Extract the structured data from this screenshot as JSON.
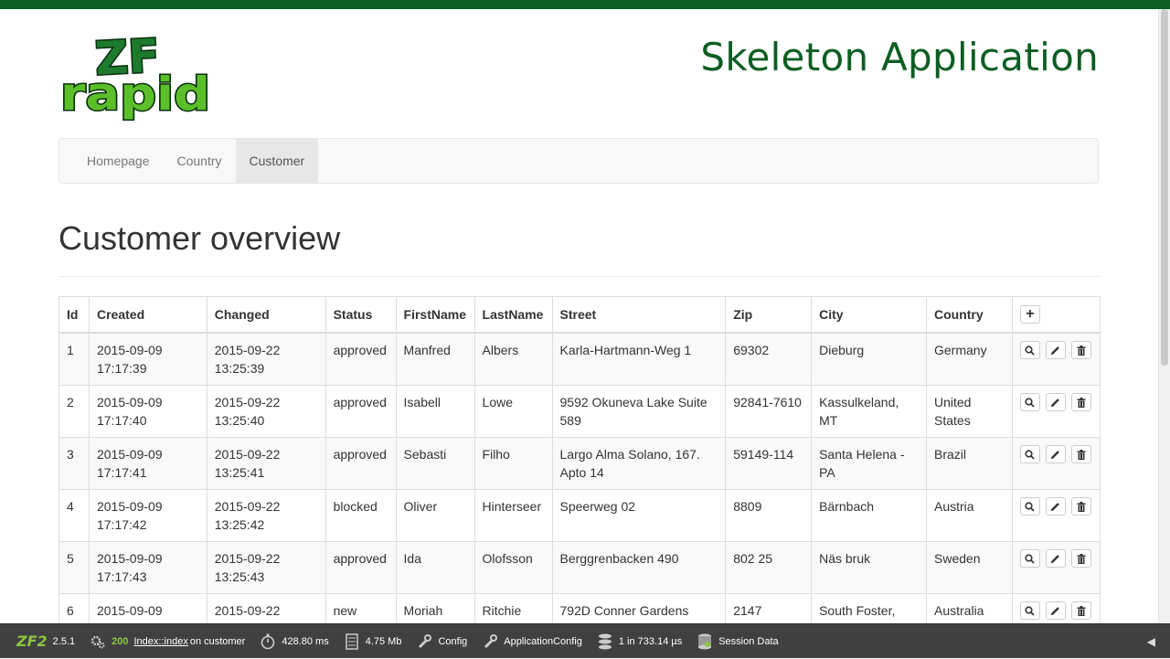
{
  "header": {
    "logo_top": "ZF",
    "logo_bottom": "rapid",
    "app_title": "Skeleton Application"
  },
  "nav": {
    "items": [
      {
        "label": "Homepage",
        "active": false
      },
      {
        "label": "Country",
        "active": false
      },
      {
        "label": "Customer",
        "active": true
      }
    ]
  },
  "page": {
    "title": "Customer overview"
  },
  "table": {
    "columns": [
      "Id",
      "Created",
      "Changed",
      "Status",
      "FirstName",
      "LastName",
      "Street",
      "Zip",
      "City",
      "Country"
    ],
    "add_icon": "plus-icon",
    "rows": [
      {
        "id": "1",
        "created_date": "2015-09-09",
        "created_time": "17:17:39",
        "changed_date": "2015-09-22",
        "changed_time": "13:25:39",
        "status": "approved",
        "firstname": "Manfred",
        "lastname": "Albers",
        "street": "Karla-Hartmann-Weg 1",
        "zip": "69302",
        "city": "Dieburg",
        "country": "Germany"
      },
      {
        "id": "2",
        "created_date": "2015-09-09",
        "created_time": "17:17:40",
        "changed_date": "2015-09-22",
        "changed_time": "13:25:40",
        "status": "approved",
        "firstname": "Isabell",
        "lastname": "Lowe",
        "street": "9592 Okuneva Lake Suite 589",
        "zip": "92841-7610",
        "city": "Kassulkeland, MT",
        "country": "United States"
      },
      {
        "id": "3",
        "created_date": "2015-09-09",
        "created_time": "17:17:41",
        "changed_date": "2015-09-22",
        "changed_time": "13:25:41",
        "status": "approved",
        "firstname": "Sebasti",
        "lastname": "Filho",
        "street": "Largo Alma Solano, 167. Apto 14",
        "zip": "59149-114",
        "city": "Santa Helena - PA",
        "country": "Brazil"
      },
      {
        "id": "4",
        "created_date": "2015-09-09",
        "created_time": "17:17:42",
        "changed_date": "2015-09-22",
        "changed_time": "13:25:42",
        "status": "blocked",
        "firstname": "Oliver",
        "lastname": "Hinterseer",
        "street": "Speerweg 02",
        "zip": "8809",
        "city": "Bärnbach",
        "country": "Austria"
      },
      {
        "id": "5",
        "created_date": "2015-09-09",
        "created_time": "17:17:43",
        "changed_date": "2015-09-22",
        "changed_time": "13:25:43",
        "status": "approved",
        "firstname": "Ida",
        "lastname": "Olofsson",
        "street": "Berggrenbacken 490",
        "zip": "802 25",
        "city": "Näs bruk",
        "country": "Sweden"
      },
      {
        "id": "6",
        "created_date": "2015-09-09",
        "created_time": "",
        "changed_date": "2015-09-22",
        "changed_time": "",
        "status": "new",
        "firstname": "Moriah",
        "lastname": "Ritchie",
        "street": "792D Conner Gardens",
        "zip": "2147",
        "city": "South Foster,",
        "country": "Australia"
      }
    ]
  },
  "toolbar": {
    "logo": "ZF2",
    "version": "2.5.1",
    "status_code": "200",
    "route": "Index::index",
    "route_on": "on",
    "route_name": "customer",
    "time": "428.80 ms",
    "memory": "4.75 Mb",
    "config": "Config",
    "app_config": "ApplicationConfig",
    "db": "1 in 733.14 µs",
    "session": "Session Data",
    "collapse_icon": "triangle-left-icon"
  },
  "colors": {
    "brand_green": "#0c5e22",
    "zf_green": "#8cc63f",
    "toolbar_bg": "#404040"
  }
}
